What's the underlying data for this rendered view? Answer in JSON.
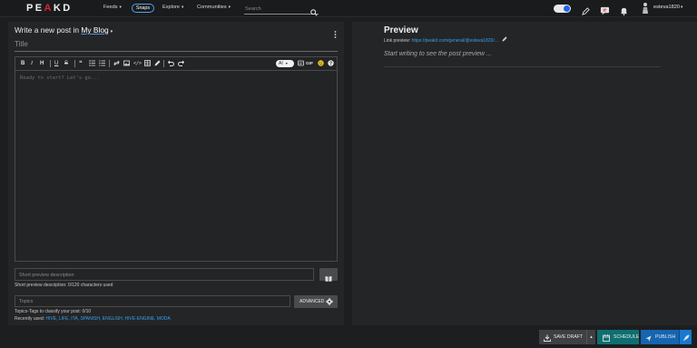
{
  "brand": {
    "logo_pre": "PE",
    "logo_e": "A",
    "logo_post": "KD"
  },
  "nav": {
    "feeds": "Feeds",
    "snaps": "Snaps",
    "explore": "Explore",
    "communities": "Communities",
    "search_placeholder": "Search"
  },
  "user": {
    "name": "esteva1820"
  },
  "editor": {
    "header_prefix": "Write a new post in",
    "blog_name": "My Blog",
    "title_placeholder": "Title",
    "body_placeholder": "Ready to start? Let's go...",
    "ai_label": "AI",
    "gif_label": "GIF",
    "toolbar_icons": [
      "bold-icon",
      "italic-icon",
      "heading-icon",
      "underline-icon",
      "strikethrough-icon",
      "quote-icon",
      "unordered-list-icon",
      "ordered-list-icon",
      "link-icon",
      "image-icon",
      "code-icon",
      "table-icon",
      "pen-icon",
      "undo-icon",
      "redo-icon",
      "emoji-icon",
      "help-icon"
    ]
  },
  "short_description": {
    "placeholder": "Short preview description",
    "hint": "Short preview description: 0/120 characters used"
  },
  "topics": {
    "placeholder": "Topics",
    "advanced_label": "ADVANCED",
    "hint": "Topics-Tags to classify your post: 0/10",
    "recent_prefix": "Recently used:",
    "recent_tags": "HIVE, LIFE, ITA, SPANISH, ENGLISH, HIVE-ENGINE, MODA"
  },
  "preview": {
    "title": "Preview",
    "link_prefix": "Link preview:",
    "link_url": "https://peakd.com/general/@esteva1820/...",
    "empty_text": "Start writing to see the post preview ..."
  },
  "actions": {
    "save_draft": "SAVE DRAFT",
    "schedule": "SCHEDULE",
    "publish": "PUBLISH"
  },
  "colors": {
    "accent_blue": "#3b9fe8",
    "brand_red": "#e21f36",
    "schedule_teal": "#0e6f70",
    "publish_blue": "#1565b0"
  }
}
